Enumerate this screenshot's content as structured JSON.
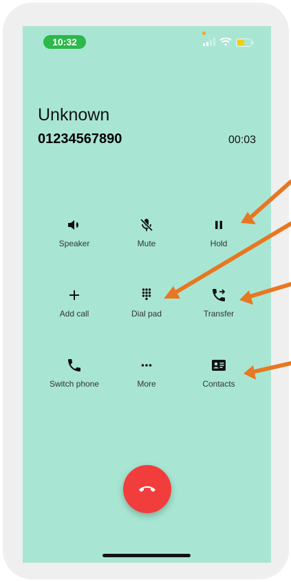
{
  "status_bar": {
    "time": "10:32",
    "colors": {
      "time_pill": "#2db84a",
      "privacy_dot": "#f5a623",
      "battery": "#f5d000"
    }
  },
  "caller": {
    "name": "Unknown",
    "number": "01234567890",
    "duration": "00:03"
  },
  "controls": [
    {
      "id": "speaker",
      "label": "Speaker",
      "icon": "speaker-icon"
    },
    {
      "id": "mute",
      "label": "Mute",
      "icon": "mic-off-icon"
    },
    {
      "id": "hold",
      "label": "Hold",
      "icon": "pause-icon"
    },
    {
      "id": "add_call",
      "label": "Add call",
      "icon": "plus-icon"
    },
    {
      "id": "dial_pad",
      "label": "Dial pad",
      "icon": "dialpad-icon"
    },
    {
      "id": "transfer",
      "label": "Transfer",
      "icon": "call-transfer-icon"
    },
    {
      "id": "switch_phone",
      "label": "Switch phone",
      "icon": "phone-icon"
    },
    {
      "id": "more",
      "label": "More",
      "icon": "more-dots-icon"
    },
    {
      "id": "contacts",
      "label": "Contacts",
      "icon": "contact-card-icon"
    }
  ],
  "end_call": {
    "icon": "end-call-icon",
    "color": "#f23d3d"
  },
  "screen_background": "#a8e6d3",
  "annotation_color": "#e87722"
}
